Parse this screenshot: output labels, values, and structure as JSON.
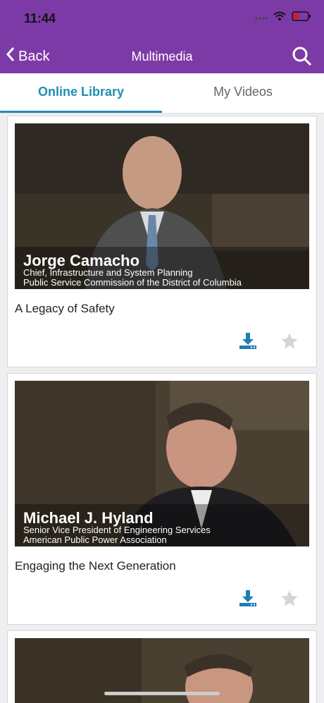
{
  "status": {
    "time": "11:44"
  },
  "nav": {
    "back": "Back",
    "title": "Multimedia"
  },
  "tabs": {
    "online": "Online Library",
    "mine": "My Videos"
  },
  "videos": [
    {
      "name": "Jorge Camacho",
      "line1": "Chief, Infrastructure and System Planning",
      "line2": "Public Service Commission of the District of Columbia",
      "title": "A Legacy of Safety"
    },
    {
      "name": "Michael J. Hyland",
      "line1": "Senior Vice President of Engineering Services",
      "line2": "American Public Power Association",
      "title": "Engaging the Next Generation"
    }
  ]
}
